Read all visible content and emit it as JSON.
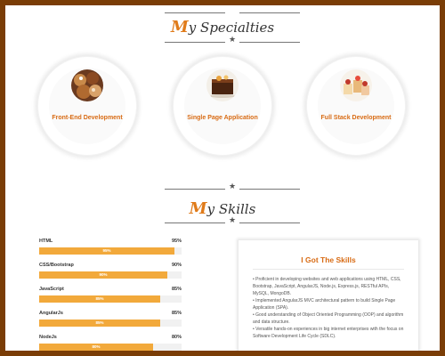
{
  "specialties": {
    "title_first": "M",
    "title_rest": "y Specialties",
    "items": [
      {
        "label": "Front-End Development"
      },
      {
        "label": "Single Page Application"
      },
      {
        "label": "Full Stack Development"
      }
    ]
  },
  "skills": {
    "title_first": "M",
    "title_rest": "y Skills",
    "items": [
      {
        "name": "HTML",
        "percent_label": "95%",
        "bar_label": "95%",
        "value": 95
      },
      {
        "name": "CSS/Bootstrap",
        "percent_label": "90%",
        "bar_label": "90%",
        "value": 90
      },
      {
        "name": "JavaScript",
        "percent_label": "85%",
        "bar_label": "85%",
        "value": 85
      },
      {
        "name": "AngularJs",
        "percent_label": "85%",
        "bar_label": "85%",
        "value": 85
      },
      {
        "name": "NodeJs",
        "percent_label": "80%",
        "bar_label": "80%",
        "value": 80
      }
    ]
  },
  "got_skills": {
    "title": "I Got The Skills",
    "bullets": [
      "• Proficient in developing websites and web applications using HTML, CSS, Bootstrap, JavaScript, AngularJS, Node.js, Express.js, RESTful APIs, MySQL, MongoDB.",
      "• Implemented AngularJS MVC architectural pattern to build Single Page Application (SPA).",
      "• Good understanding of Object Oriented Programming (OOP) and algorithm and data structure.",
      "• Versatile hands-on experiences in big internet enterprises with the focus on Software Development Life Cycle (SDLC)."
    ]
  },
  "colors": {
    "accent": "#e07b1a",
    "bar": "#f2a93b",
    "frame": "#7a3d06"
  },
  "icons": [
    "star-icon",
    "cupcakes-photo",
    "brownie-cake-photo",
    "dessert-cups-photo"
  ]
}
